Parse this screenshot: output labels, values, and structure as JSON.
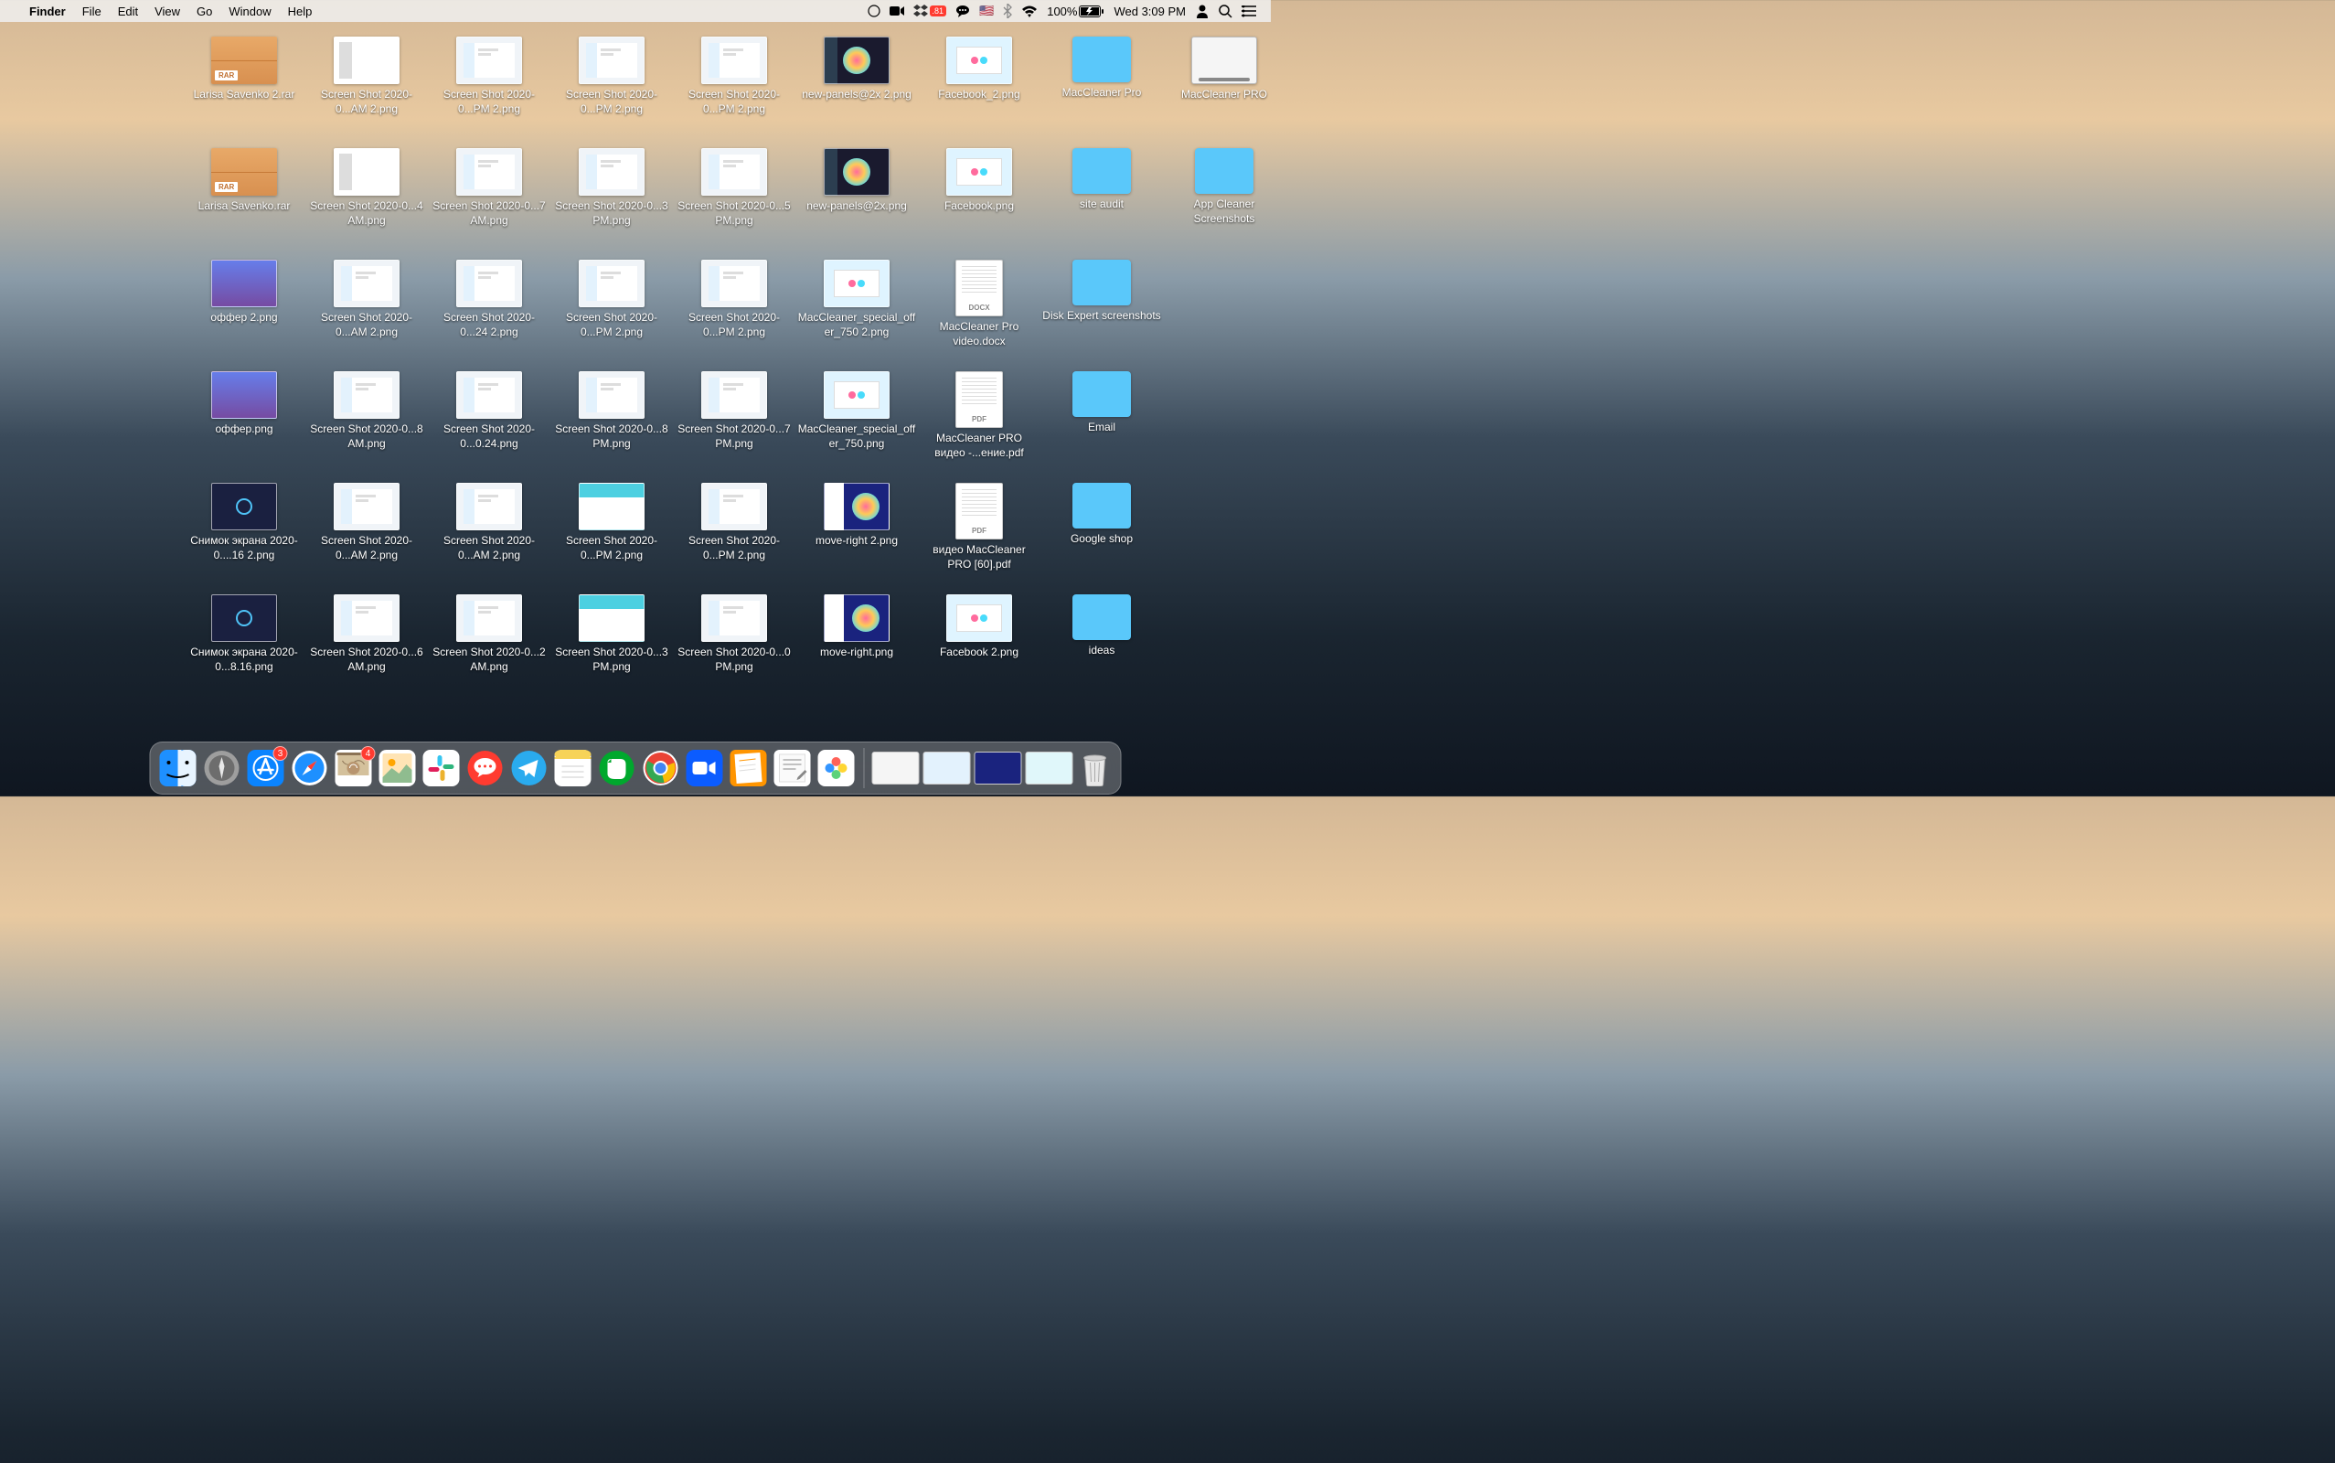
{
  "menubar": {
    "app_name": "Finder",
    "menus": [
      "File",
      "Edit",
      "View",
      "Go",
      "Window",
      "Help"
    ],
    "battery_pct": "100%",
    "clock": "Wed 3:09 PM",
    "dropbox_badge": ".81"
  },
  "desktop_icons": [
    {
      "name": "Larisa Savenko 2.rar",
      "type": "rar"
    },
    {
      "name": "Screen Shot 2020-0...AM 2.png",
      "type": "ss-app"
    },
    {
      "name": "Screen Shot 2020-0...PM 2.png",
      "type": "ss-light"
    },
    {
      "name": "Screen Shot 2020-0...PM 2.png",
      "type": "ss-light"
    },
    {
      "name": "Screen Shot 2020-0...PM 2.png",
      "type": "ss-light"
    },
    {
      "name": "new-panels@2x 2.png",
      "type": "panel"
    },
    {
      "name": "Facebook_2.png",
      "type": "fb"
    },
    {
      "name": "MacCleaner Pro",
      "type": "folder"
    },
    {
      "name": "MacCleaner PRO",
      "type": "hdd"
    },
    {
      "name": "Larisa Savenko.rar",
      "type": "rar"
    },
    {
      "name": "Screen Shot 2020-0...4 AM.png",
      "type": "ss-app"
    },
    {
      "name": "Screen Shot 2020-0...7 AM.png",
      "type": "ss-light"
    },
    {
      "name": "Screen Shot 2020-0...3 PM.png",
      "type": "ss-light"
    },
    {
      "name": "Screen Shot 2020-0...5 PM.png",
      "type": "ss-light"
    },
    {
      "name": "new-panels@2x.png",
      "type": "panel"
    },
    {
      "name": "Facebook.png",
      "type": "fb"
    },
    {
      "name": "site audit",
      "type": "folder"
    },
    {
      "name": "App Cleaner Screenshots",
      "type": "folder"
    },
    {
      "name": "оффер 2.png",
      "type": "ss-purple"
    },
    {
      "name": "Screen Shot 2020-0...AM 2.png",
      "type": "ss-light"
    },
    {
      "name": "Screen Shot 2020-0...24 2.png",
      "type": "ss-light"
    },
    {
      "name": "Screen Shot 2020-0...PM 2.png",
      "type": "ss-light"
    },
    {
      "name": "Screen Shot 2020-0...PM 2.png",
      "type": "ss-light"
    },
    {
      "name": "MacCleaner_special_offer_750 2.png",
      "type": "fb"
    },
    {
      "name": "MacCleaner Pro video.docx",
      "type": "docx"
    },
    {
      "name": "Disk Expert screenshots",
      "type": "folder"
    },
    {
      "name": "",
      "type": "empty"
    },
    {
      "name": "оффер.png",
      "type": "ss-purple"
    },
    {
      "name": "Screen Shot 2020-0...8 AM.png",
      "type": "ss-light"
    },
    {
      "name": "Screen Shot 2020-0...0.24.png",
      "type": "ss-light"
    },
    {
      "name": "Screen Shot 2020-0...8 PM.png",
      "type": "ss-light"
    },
    {
      "name": "Screen Shot 2020-0...7 PM.png",
      "type": "ss-light"
    },
    {
      "name": "MacCleaner_special_offer_750.png",
      "type": "fb"
    },
    {
      "name": "MacCleaner PRO видео -...ение.pdf",
      "type": "pdf"
    },
    {
      "name": "Email",
      "type": "folder"
    },
    {
      "name": "",
      "type": "empty"
    },
    {
      "name": "Снимок экрана 2020-0....16 2.png",
      "type": "ss-dark"
    },
    {
      "name": "Screen Shot 2020-0...AM 2.png",
      "type": "ss-light"
    },
    {
      "name": "Screen Shot 2020-0...AM 2.png",
      "type": "ss-light"
    },
    {
      "name": "Screen Shot 2020-0...PM 2.png",
      "type": "ss-teal"
    },
    {
      "name": "Screen Shot 2020-0...PM 2.png",
      "type": "ss-light"
    },
    {
      "name": "move-right 2.png",
      "type": "move"
    },
    {
      "name": "видео MacCleaner PRO [60].pdf",
      "type": "pdf"
    },
    {
      "name": "Google shop",
      "type": "folder"
    },
    {
      "name": "",
      "type": "empty"
    },
    {
      "name": "Снимок экрана 2020-0...8.16.png",
      "type": "ss-dark"
    },
    {
      "name": "Screen Shot 2020-0...6 AM.png",
      "type": "ss-light"
    },
    {
      "name": "Screen Shot 2020-0...2 AM.png",
      "type": "ss-light"
    },
    {
      "name": "Screen Shot 2020-0...3 PM.png",
      "type": "ss-teal"
    },
    {
      "name": "Screen Shot 2020-0...0 PM.png",
      "type": "ss-light"
    },
    {
      "name": "move-right.png",
      "type": "move"
    },
    {
      "name": "Facebook 2.png",
      "type": "fb"
    },
    {
      "name": "ideas",
      "type": "folder"
    },
    {
      "name": "",
      "type": "empty"
    }
  ],
  "dock": {
    "apps": [
      {
        "name": "finder",
        "color": "#1e90ff",
        "badge": null
      },
      {
        "name": "launchpad",
        "color": "#888",
        "badge": null
      },
      {
        "name": "app-store",
        "color": "#0a84ff",
        "badge": "3"
      },
      {
        "name": "safari",
        "color": "#0a84ff",
        "badge": null
      },
      {
        "name": "mail",
        "color": "#d0b48c",
        "badge": "4"
      },
      {
        "name": "photos",
        "color": "#fff",
        "badge": null
      },
      {
        "name": "slack",
        "color": "#4a154b",
        "badge": null
      },
      {
        "name": "imessage",
        "color": "#ff3b30",
        "badge": null
      },
      {
        "name": "telegram",
        "color": "#2aabee",
        "badge": null
      },
      {
        "name": "notes",
        "color": "#f7d358",
        "badge": null
      },
      {
        "name": "evernote",
        "color": "#00a82d",
        "badge": null
      },
      {
        "name": "chrome",
        "color": "#fff",
        "badge": null
      },
      {
        "name": "zoom",
        "color": "#0b5cff",
        "badge": null
      },
      {
        "name": "pages",
        "color": "#ff9500",
        "badge": null
      },
      {
        "name": "textedit",
        "color": "#fff",
        "badge": null
      },
      {
        "name": "photos-app",
        "color": "#fff",
        "badge": null
      }
    ],
    "previews": 4
  }
}
